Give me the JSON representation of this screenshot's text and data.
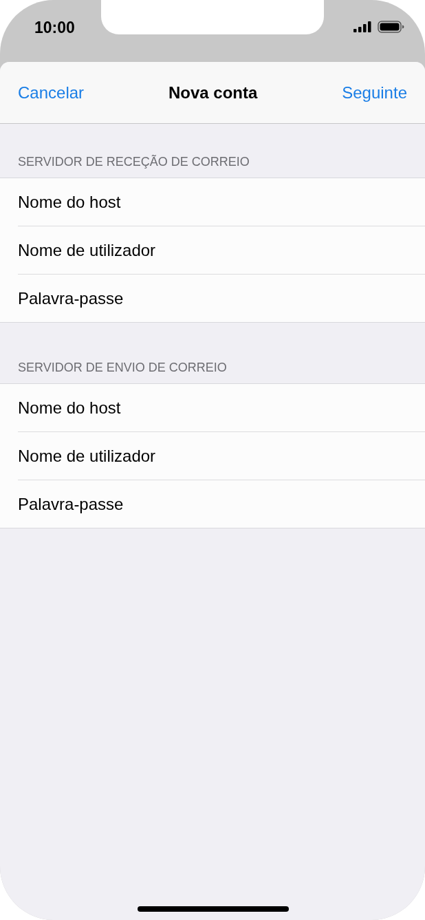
{
  "status_bar": {
    "time": "10:00"
  },
  "nav_bar": {
    "left_button": "Cancelar",
    "title": "Nova conta",
    "right_button": "Seguinte"
  },
  "sections": [
    {
      "header": "SERVIDOR DE RECEÇÃO DE CORREIO",
      "rows": [
        {
          "label": "Nome do host"
        },
        {
          "label": "Nome de utilizador"
        },
        {
          "label": "Palavra-passe"
        }
      ]
    },
    {
      "header": "SERVIDOR DE ENVIO DE CORREIO",
      "rows": [
        {
          "label": "Nome do host"
        },
        {
          "label": "Nome de utilizador"
        },
        {
          "label": "Palavra-passe"
        }
      ]
    }
  ]
}
